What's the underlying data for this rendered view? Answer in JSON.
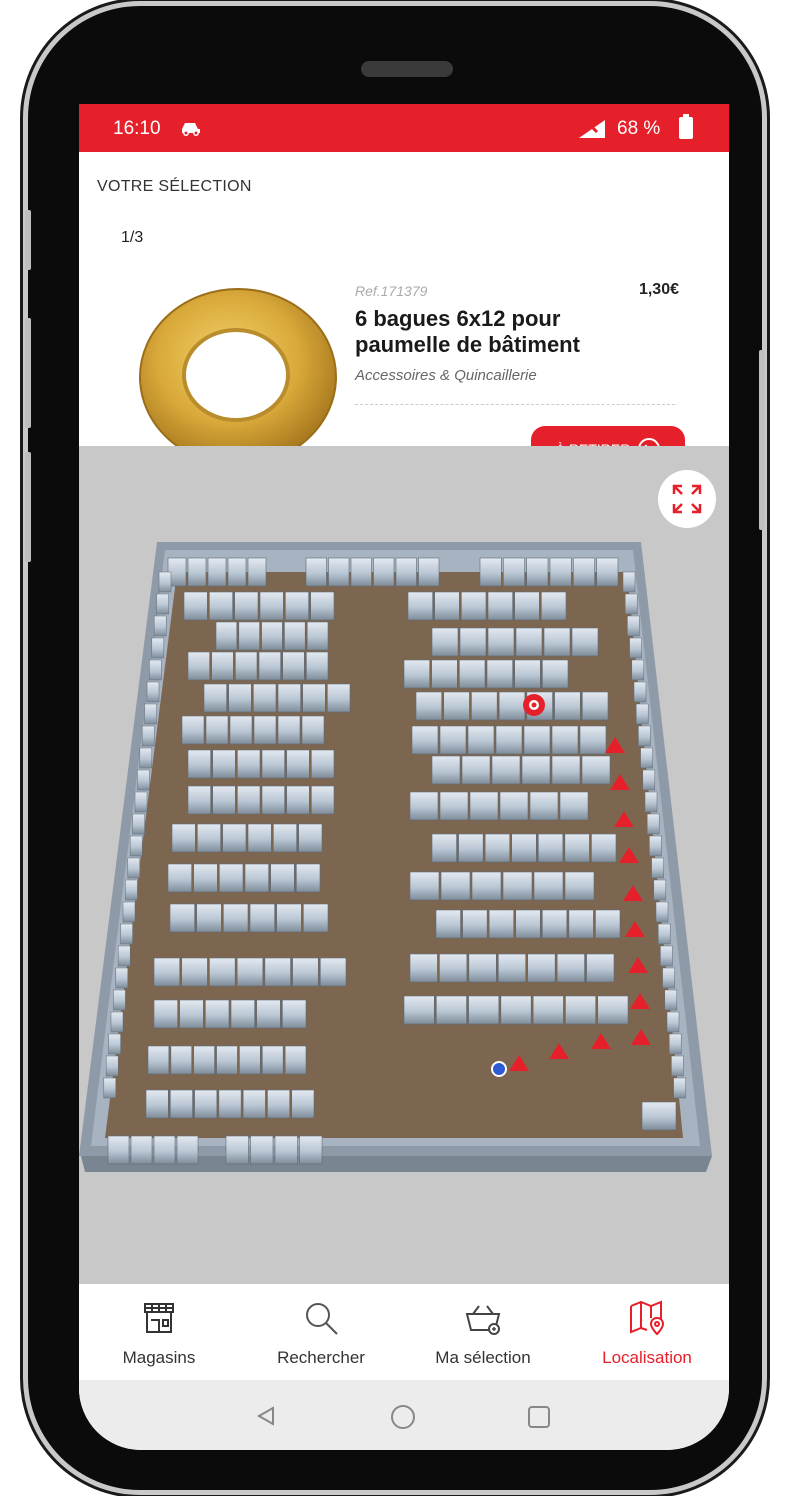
{
  "status_bar": {
    "time": "16:10",
    "battery": "68 %",
    "battery_level": 68
  },
  "selection": {
    "section_title": "VOTRE SÉLECTION",
    "counter": "1/3",
    "ref": "Ref.171379",
    "price": "1,30€",
    "product_name": "6 bagues 6x12 pour paumelle de bâtiment",
    "category": "Accessoires & Quincaillerie",
    "action_button": "À RETIRER"
  },
  "map": {
    "expand_icon": "expand-icon",
    "colors": {
      "accent": "#e5202a",
      "floor": "#7d6650",
      "shelf": "#c9d3de"
    }
  },
  "nav": {
    "items": [
      {
        "label": "Magasins",
        "icon": "store-icon"
      },
      {
        "label": "Rechercher",
        "icon": "search-icon"
      },
      {
        "label": "Ma sélection",
        "icon": "basket-icon"
      },
      {
        "label": "Localisation",
        "icon": "map-pin-icon",
        "active": true
      }
    ]
  }
}
